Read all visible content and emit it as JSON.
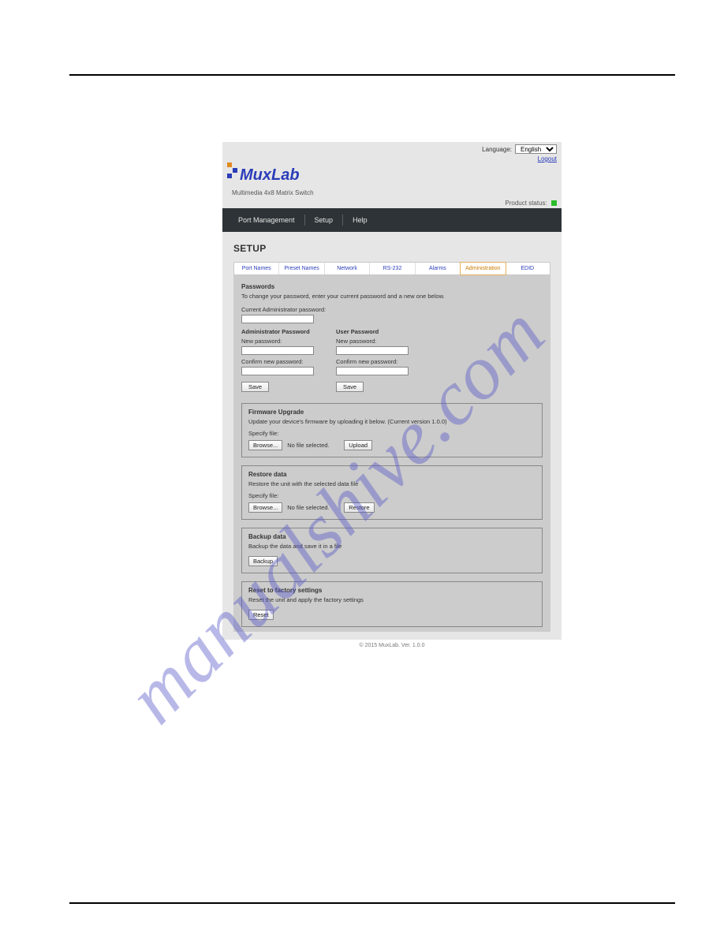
{
  "watermark": "manualshive.com",
  "header": {
    "language_label": "Language:",
    "language_value": "English",
    "logout": "Logout",
    "brand": "MuxLab",
    "subtitle": "Multimedia 4x8 Matrix Switch",
    "product_status_label": "Product status:"
  },
  "nav": {
    "port_management": "Port Management",
    "setup": "Setup",
    "help": "Help"
  },
  "page": {
    "title": "SETUP",
    "tabs": {
      "port_names": "Port Names",
      "preset_names": "Preset Names",
      "network": "Network",
      "rs232": "RS-232",
      "alarms": "Alarms",
      "administration": "Administration",
      "edid": "EDID"
    }
  },
  "passwords": {
    "title": "Passwords",
    "desc": "To change your password, enter your current password and a new one below.",
    "current_label": "Current Administrator password:",
    "admin_head": "Administrator Password",
    "user_head": "User Password",
    "new_label": "New password:",
    "confirm_label": "Confirm new password:",
    "save": "Save"
  },
  "firmware": {
    "title": "Firmware Upgrade",
    "desc": "Update your device's firmware by uploading it below. (Current version 1.0.0)",
    "specify": "Specify file:",
    "browse": "Browse...",
    "no_file": "No file selected.",
    "upload": "Upload"
  },
  "restore": {
    "title": "Restore data",
    "desc": "Restore the unit with the selected data file",
    "specify": "Specify file:",
    "browse": "Browse...",
    "no_file": "No file selected.",
    "restore_btn": "Restore"
  },
  "backup": {
    "title": "Backup data",
    "desc": "Backup the data and save it in a file",
    "backup_btn": "Backup"
  },
  "reset": {
    "title": "Reset to factory settings",
    "desc": "Reset the unit and apply the factory settings",
    "reset_btn": "Reset"
  },
  "footer": "© 2015 MuxLab. Ver. 1.0.0"
}
